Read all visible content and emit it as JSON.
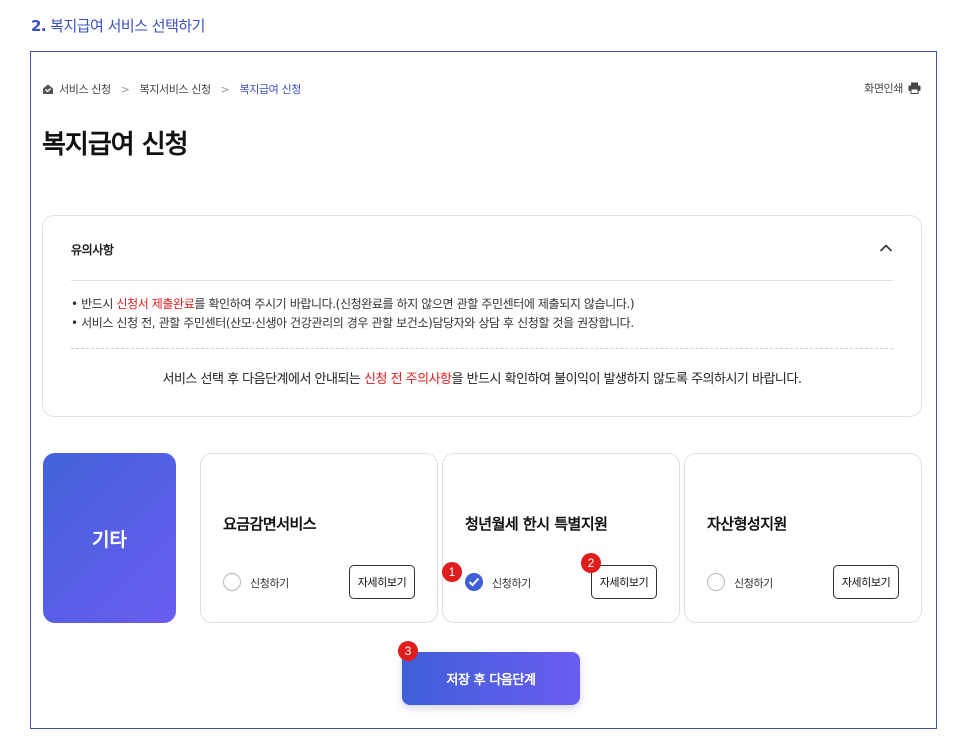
{
  "step": {
    "number": "2.",
    "title": "복지급여 서비스 선택하기"
  },
  "breadcrumb": {
    "items": [
      "서비스 신청",
      "복지서비스 신청",
      "복지급여 신청"
    ],
    "separator": ">"
  },
  "print_label": "화면인쇄",
  "page_title": "복지급여 신청",
  "notice": {
    "title": "유의사항",
    "line1": {
      "pre": "반드시 ",
      "highlight": "신청서 제출완료",
      "post": "를 확인하여 주시기 바랍니다.(신청완료를 하지 않으면 관할 주민센터에 제출되지 않습니다.)"
    },
    "line2": "서비스 신청 전, 관할 주민센터(산모·신생아 건강관리의 경우 관할 보건소)담당자와 상담 후 신청할 것을 권장합니다.",
    "footer": {
      "pre": "서비스 선택 후 다음단계에서 안내되는 ",
      "highlight": "신청 전 주의사항",
      "post": "을 반드시 확인하여 불이익이 발생하지 않도록 주의하시기 바랍니다."
    }
  },
  "category_label": "기타",
  "services": [
    {
      "title": "요금감면서비스",
      "apply_label": "신청하기",
      "detail_label": "자세히보기",
      "checked": false
    },
    {
      "title": "청년월세 한시 특별지원",
      "apply_label": "신청하기",
      "detail_label": "자세히보기",
      "checked": true
    },
    {
      "title": "자산형성지원",
      "apply_label": "신청하기",
      "detail_label": "자세히보기",
      "checked": false
    }
  ],
  "next_button": "저장 후 다음단계",
  "markers": [
    "1",
    "2",
    "3"
  ],
  "colors": {
    "accent": "#3f5fd8",
    "highlight": "#e02020",
    "marker": "#e01c1c"
  }
}
